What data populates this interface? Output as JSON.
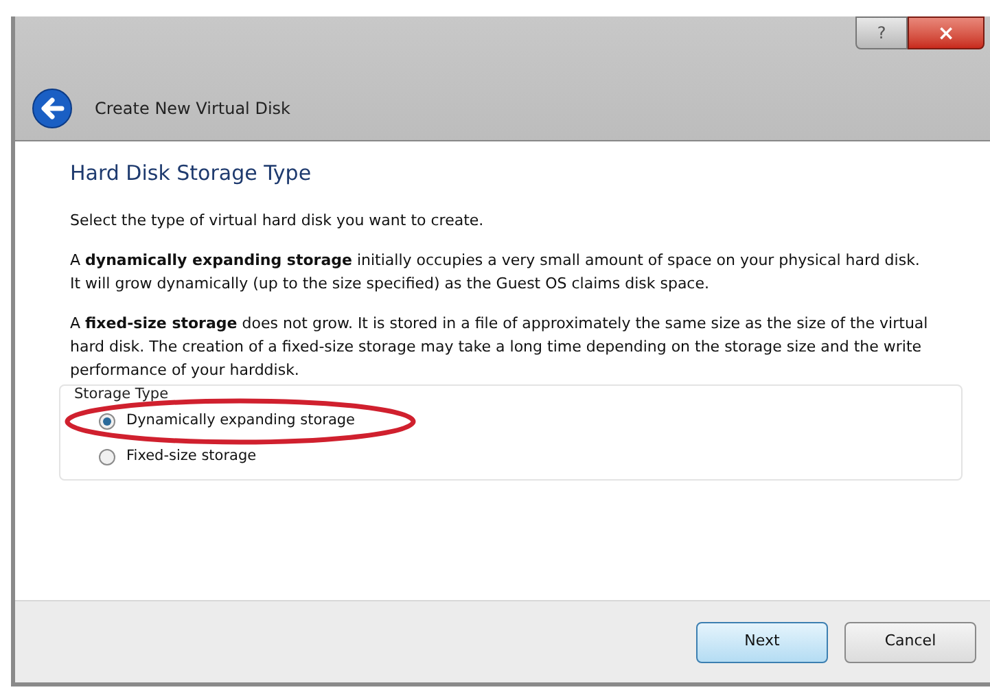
{
  "window": {
    "title": "Create New Virtual Disk",
    "controls": [
      {
        "kind": "help",
        "label": "?"
      },
      {
        "kind": "close",
        "label": "×"
      }
    ]
  },
  "page": {
    "heading": "Hard Disk Storage Type",
    "paragraphs": [
      "Select the type of virtual hard disk you want to create.",
      "A **dynamically expanding storage** initially occupies a very small amount of space on your physical hard disk. It will grow dynamically (up to the size specified) as the Guest OS claims disk space.",
      "A **fixed-size storage** does not grow. It is stored in a file of approximately the same size as the size of the virtual hard disk. The creation of a fixed-size storage may take a long time depending on the storage size and the write performance of your harddisk."
    ]
  },
  "storage_type": {
    "title": "Storage Type",
    "options": [
      {
        "label": "Dynamically expanding storage",
        "selected": true,
        "circled": true
      },
      {
        "label": "Fixed-size storage",
        "selected": false,
        "circled": false
      }
    ]
  },
  "buttons": [
    {
      "label": "Next",
      "default": true
    },
    {
      "label": "Cancel",
      "default": false
    }
  ]
}
